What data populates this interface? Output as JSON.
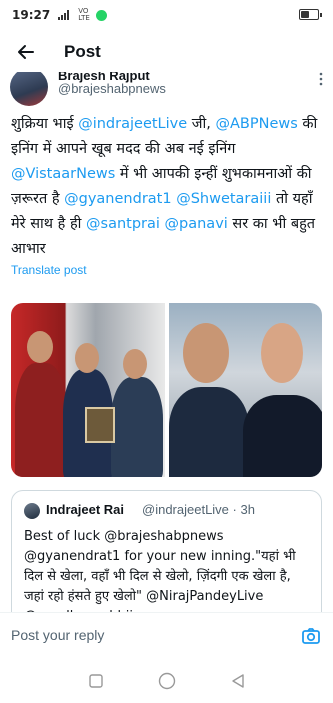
{
  "status_bar": {
    "time": "19:27",
    "network": "VO LTE"
  },
  "header": {
    "title": "Post"
  },
  "author": {
    "name": "Brajesh Rajput",
    "handle": "@brajeshabpnews"
  },
  "post": {
    "segments": [
      {
        "t": "शुक्रिया भाई ",
        "m": false
      },
      {
        "t": "@indrajeetLive",
        "m": true
      },
      {
        "t": " जी, ",
        "m": false
      },
      {
        "t": "@ABPNews",
        "m": true
      },
      {
        "t": " की इनिंग में आपने खूब मदद की अब नई इनिंग ",
        "m": false
      },
      {
        "t": "@VistaarNews",
        "m": true
      },
      {
        "t": " में भी आपकी इन्हीं शुभकामनाओं की ज़रूरत है ",
        "m": false
      },
      {
        "t": "@gyanendrat1",
        "m": true
      },
      {
        "t": " ",
        "m": false
      },
      {
        "t": "@Shwetaraiii",
        "m": true
      },
      {
        "t": " तो यहाँ मेरे साथ है ही ",
        "m": false
      },
      {
        "t": "@santprai",
        "m": true
      },
      {
        "t": " ",
        "m": false
      },
      {
        "t": "@panavi",
        "m": true
      },
      {
        "t": " सर का भी बहुत आभार",
        "m": false
      }
    ],
    "translate_label": "Translate post"
  },
  "quote": {
    "name": "Indrajeet Rai",
    "meta": "@indrajeetLive · 3h",
    "text": "Best of luck @brajeshabpnews @gyanendrat1 for your new inning.\"यहां भी दिल से खेला, वहाँ भी दिल से खेलो, ज़िंदगी एक खेला है, जहां रहो हंसते हुए खेलो\" @NirajPandeyLive @upadhyayabhii"
  },
  "reply": {
    "placeholder": "Post your reply"
  },
  "icons": {
    "back": "back-arrow-icon",
    "more": "more-vertical-icon",
    "camera": "camera-icon",
    "nav_recent": "square-icon",
    "nav_home": "circle-icon",
    "nav_back": "triangle-back-icon"
  },
  "colors": {
    "accent": "#1d9bf0",
    "text": "#0f1419",
    "muted": "#536471"
  }
}
